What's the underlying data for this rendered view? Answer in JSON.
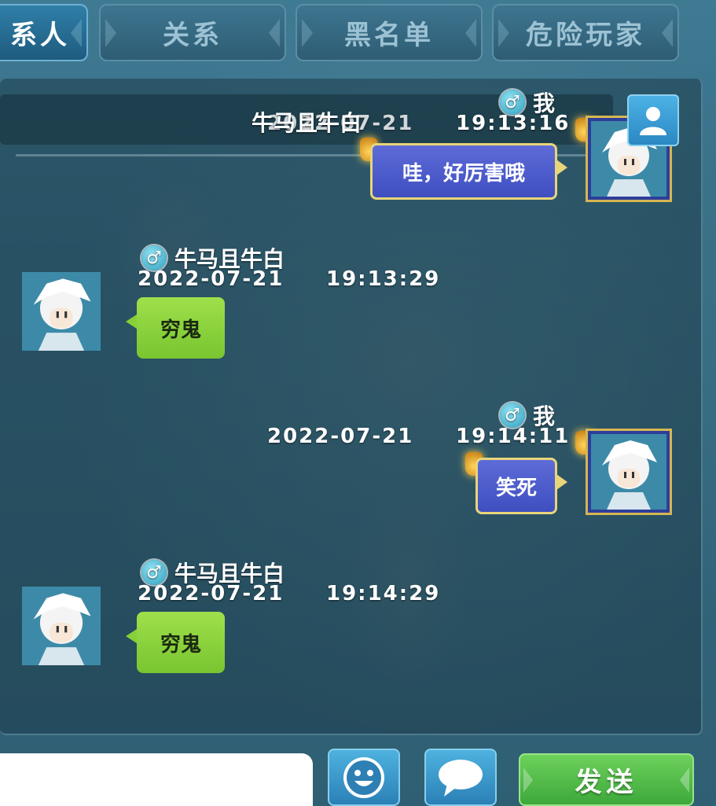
{
  "tabs": [
    {
      "label": "系人",
      "active": true
    },
    {
      "label": "关系",
      "active": false
    },
    {
      "label": "黑名单",
      "active": false
    },
    {
      "label": "危险玩家",
      "active": false
    }
  ],
  "header_overlay": {
    "contact_name": "牛马且牛白"
  },
  "messages": [
    {
      "sender": "我",
      "gender_symbol": "♂",
      "date": "2022-07-21",
      "time": "19:13:16",
      "text": "哇，好厉害哦",
      "self": true
    },
    {
      "sender": "牛马且牛白",
      "gender_symbol": "♂",
      "date": "2022-07-21",
      "time": "19:13:29",
      "text": "穷鬼",
      "self": false
    },
    {
      "sender": "我",
      "gender_symbol": "♂",
      "date": "2022-07-21",
      "time": "19:14:11",
      "text": "笑死",
      "self": true
    },
    {
      "sender": "牛马且牛白",
      "gender_symbol": "♂",
      "date": "2022-07-21",
      "time": "19:14:29",
      "text": "穷鬼",
      "self": false
    }
  ],
  "composer": {
    "input_value": "",
    "send_label": "发送",
    "emoji_icon": "smiley-icon",
    "quick_phrase_icon": "speech-bubble-icon"
  },
  "colors": {
    "active_tab": "#2f7fa8",
    "self_bubble": "#4f5dcc",
    "other_bubble": "#8dd43e",
    "send_button": "#4fbf48"
  }
}
